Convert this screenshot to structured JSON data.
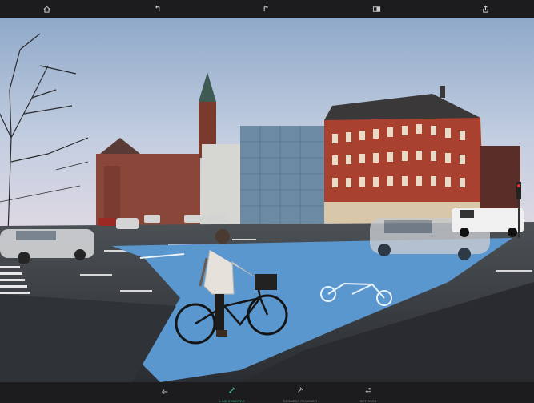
{
  "toolbar": {
    "icons": [
      "home-icon",
      "undo-icon",
      "redo-icon",
      "compare-icon",
      "share-icon"
    ]
  },
  "image": {
    "description_icon": "photo-canvas"
  },
  "bottom_bar": {
    "back_icon": "back-arrow-icon",
    "tools": [
      {
        "label": "LINE REMOVER",
        "icon": "line-remover-icon",
        "active": true
      },
      {
        "label": "SEGMENT REMOVER",
        "icon": "segment-remover-icon",
        "active": false
      },
      {
        "label": "SETTINGS",
        "icon": "settings-sliders-icon",
        "active": false
      }
    ]
  },
  "colors": {
    "accent": "#3fb98a",
    "bar_bg": "#1c1c1e",
    "icon": "#d0d0d4"
  }
}
